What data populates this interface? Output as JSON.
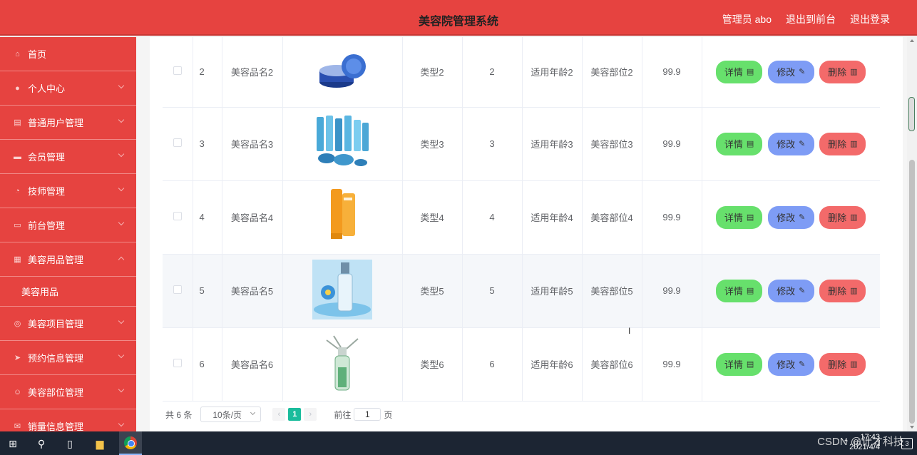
{
  "header": {
    "title": "美容院管理系统",
    "user": "管理员 abo",
    "back_to_front": "退出到前台",
    "logout": "退出登录"
  },
  "sidebar": {
    "items": [
      {
        "label": "首页",
        "icon": "home-icon",
        "expandable": false
      },
      {
        "label": "个人中心",
        "icon": "user-icon",
        "expandable": true
      },
      {
        "label": "普通用户管理",
        "icon": "clipboard-icon",
        "expandable": true
      },
      {
        "label": "会员管理",
        "icon": "briefcase-icon",
        "expandable": true
      },
      {
        "label": "技师管理",
        "icon": "clock-icon",
        "expandable": true
      },
      {
        "label": "前台管理",
        "icon": "tray-icon",
        "expandable": true
      },
      {
        "label": "美容用品管理",
        "icon": "list-icon",
        "expandable": true,
        "expanded": true
      },
      {
        "label": "美容项目管理",
        "icon": "target-icon",
        "expandable": true
      },
      {
        "label": "预约信息管理",
        "icon": "send-icon",
        "expandable": true
      },
      {
        "label": "美容部位管理",
        "icon": "smile-icon",
        "expandable": true
      },
      {
        "label": "销量信息管理",
        "icon": "mail-icon",
        "expandable": true
      }
    ],
    "submenu": "美容用品"
  },
  "table": {
    "rows": [
      {
        "id": "2",
        "name": "美容品名2",
        "type": "类型2",
        "qty": "2",
        "age": "适用年龄2",
        "part": "美容部位2",
        "price": "99.9"
      },
      {
        "id": "3",
        "name": "美容品名3",
        "type": "类型3",
        "qty": "3",
        "age": "适用年龄3",
        "part": "美容部位3",
        "price": "99.9"
      },
      {
        "id": "4",
        "name": "美容品名4",
        "type": "类型4",
        "qty": "4",
        "age": "适用年龄4",
        "part": "美容部位4",
        "price": "99.9"
      },
      {
        "id": "5",
        "name": "美容品名5",
        "type": "类型5",
        "qty": "5",
        "age": "适用年龄5",
        "part": "美容部位5",
        "price": "99.9"
      },
      {
        "id": "6",
        "name": "美容品名6",
        "type": "类型6",
        "qty": "6",
        "age": "适用年龄6",
        "part": "美容部位6",
        "price": "99.9"
      }
    ],
    "actions": {
      "detail": "详情",
      "edit": "修改",
      "delete": "删除"
    }
  },
  "pager": {
    "total": "共 6 条",
    "page_size": "10条/页",
    "current_page": "1",
    "goto_label": "前往",
    "goto_value": "1",
    "page_suffix": "页"
  },
  "taskbar": {
    "watermark": "CSDN @计才科技",
    "time": "17:43",
    "date": "2021/4/4",
    "notif_count": "3"
  },
  "colors": {
    "primary": "#e64340",
    "detail_btn": "#67e06c",
    "edit_btn": "#7e9cf5",
    "delete_btn": "#f36a6a",
    "pager_active": "#1abc9c"
  }
}
